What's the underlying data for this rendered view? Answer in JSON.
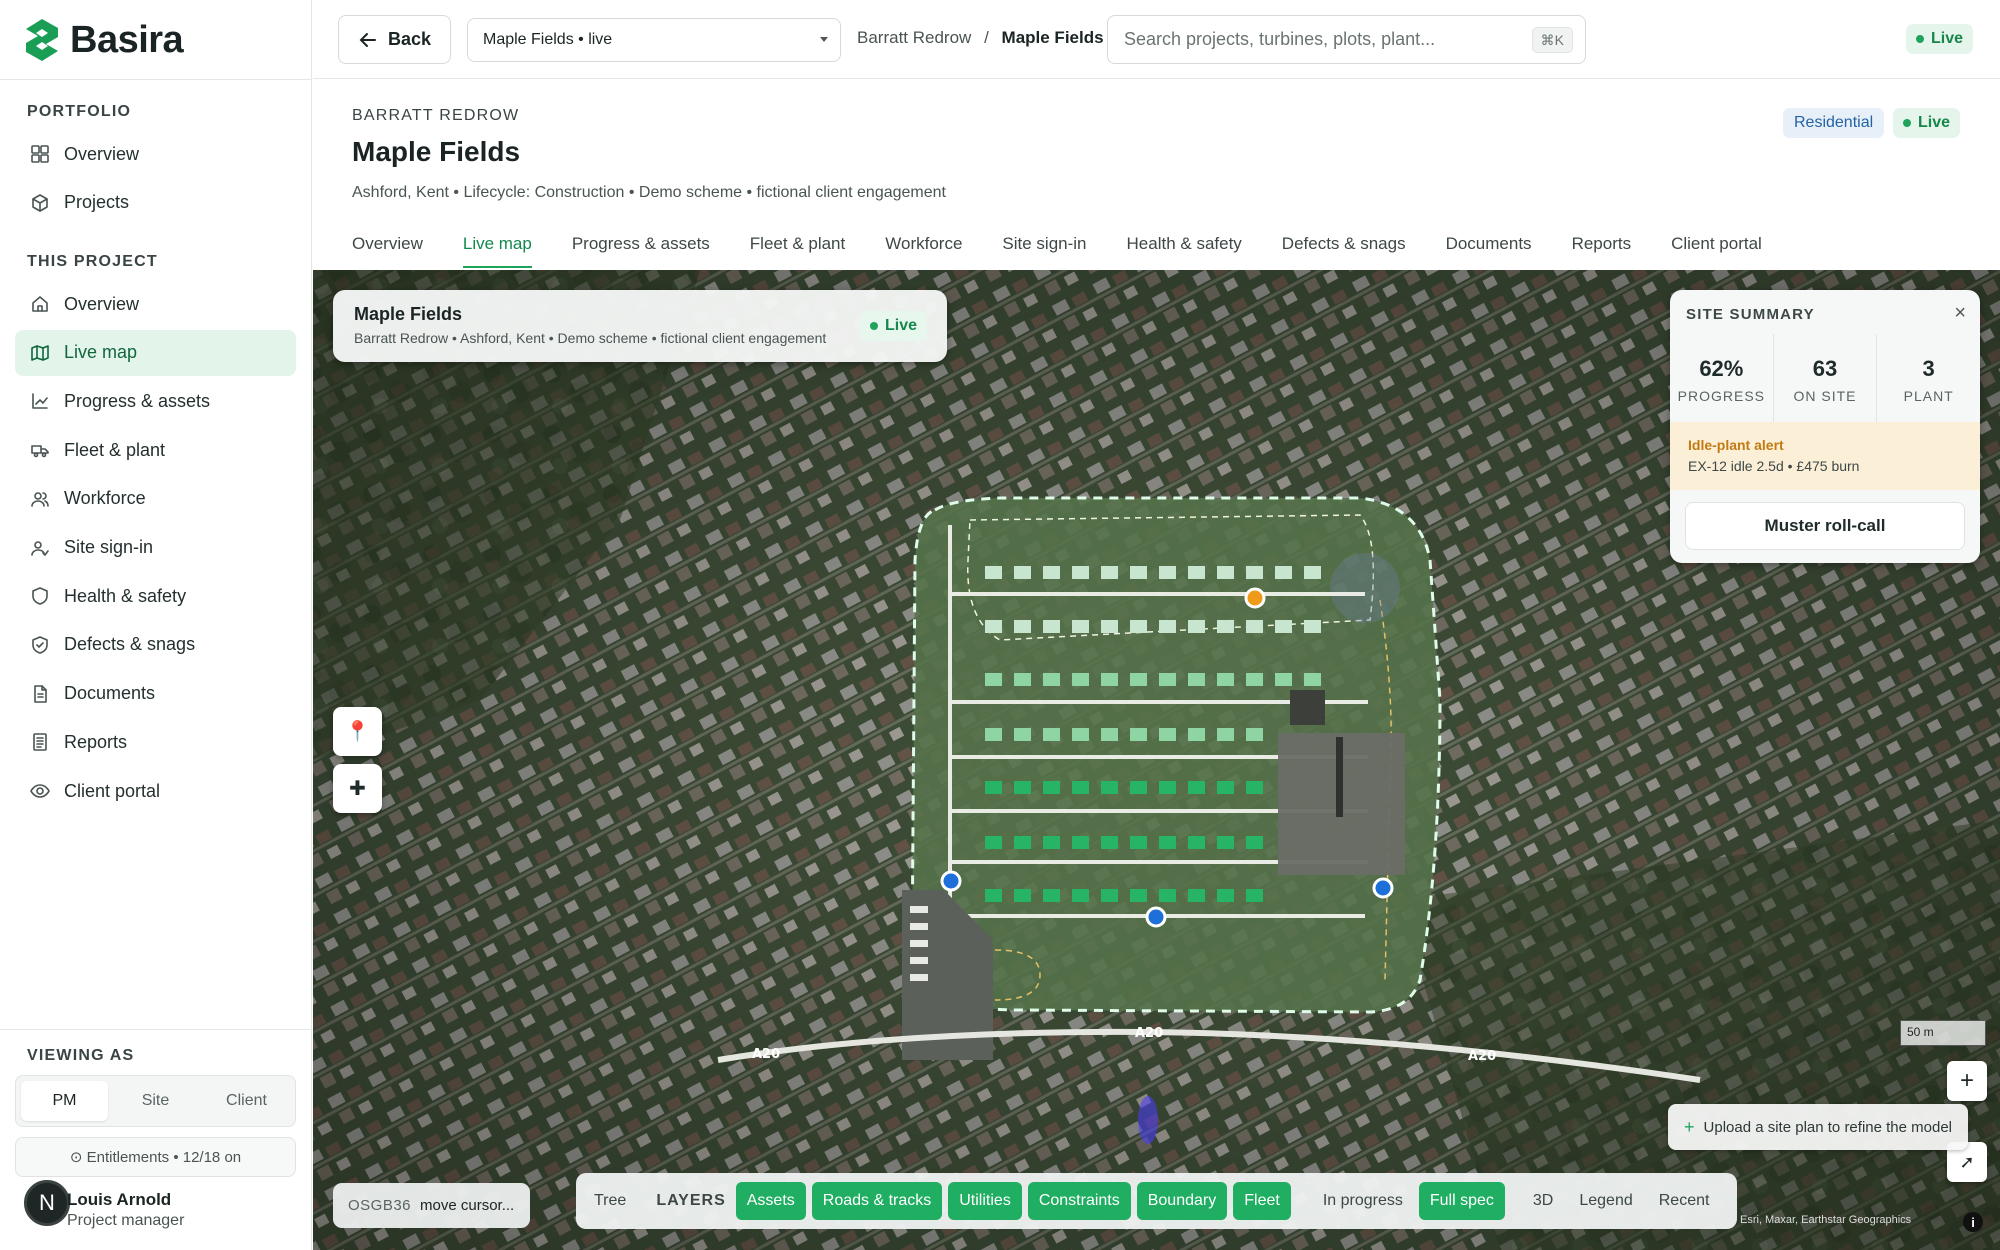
{
  "app": {
    "name": "Basira"
  },
  "sidebar": {
    "portfolio_heading": "PORTFOLIO",
    "portfolio_items": [
      {
        "label": "Overview",
        "icon": "grid-icon"
      },
      {
        "label": "Projects",
        "icon": "box-icon"
      }
    ],
    "project_heading": "THIS PROJECT",
    "project_items": [
      {
        "label": "Overview",
        "icon": "home-icon"
      },
      {
        "label": "Live map",
        "icon": "map-icon",
        "active": true
      },
      {
        "label": "Progress & assets",
        "icon": "chart-icon"
      },
      {
        "label": "Fleet & plant",
        "icon": "truck-icon"
      },
      {
        "label": "Workforce",
        "icon": "users-icon"
      },
      {
        "label": "Site sign-in",
        "icon": "user-check-icon"
      },
      {
        "label": "Health & safety",
        "icon": "shield-icon"
      },
      {
        "label": "Defects & snags",
        "icon": "shield-check-icon"
      },
      {
        "label": "Documents",
        "icon": "document-icon"
      },
      {
        "label": "Reports",
        "icon": "report-icon"
      },
      {
        "label": "Client portal",
        "icon": "eye-icon"
      }
    ],
    "viewing_heading": "VIEWING AS",
    "viewing_options": [
      "PM",
      "Site",
      "Client"
    ],
    "viewing_selected": "PM",
    "entitlements": "⊙ Entitlements • 12/18 on",
    "user": {
      "initial": "N",
      "name": "Louis Arnold",
      "role": "Project manager"
    }
  },
  "topbar": {
    "back_label": "Back",
    "project_select": "Maple Fields • live",
    "breadcrumb": {
      "parent": "Barratt Redrow",
      "separator": "/",
      "current": "Maple Fields"
    },
    "search_placeholder": "Search projects, turbines, plots, plant...",
    "search_shortcut": "⌘K",
    "status": "Live"
  },
  "header": {
    "kicker": "BARRATT REDROW",
    "title": "Maple Fields",
    "subtitle": "Ashford, Kent • Lifecycle: Construction • Demo scheme • fictional client engagement",
    "badge_type": "Residential",
    "badge_status": "Live"
  },
  "tabs": [
    "Overview",
    "Live map",
    "Progress & assets",
    "Fleet & plant",
    "Workforce",
    "Site sign-in",
    "Health & safety",
    "Defects & snags",
    "Documents",
    "Reports",
    "Client portal"
  ],
  "tabs_active": "Live map",
  "map": {
    "info": {
      "title": "Maple Fields",
      "subtitle": "Barratt Redrow • Ashford, Kent • Demo scheme • fictional client engagement",
      "status": "Live"
    },
    "summary": {
      "heading": "SITE SUMMARY",
      "stats": [
        {
          "value": "62%",
          "label": "PROGRESS"
        },
        {
          "value": "63",
          "label": "ON SITE"
        },
        {
          "value": "3",
          "label": "PLANT"
        }
      ],
      "alert_title": "Idle-plant alert",
      "alert_text": "EX-12 idle 2.5d • £475 burn",
      "action": "Muster roll-call"
    },
    "road_labels": [
      "A20",
      "A20",
      "A20"
    ],
    "scale_label": "50 m",
    "upload_label": "Upload a site plan to refine the model",
    "coords": {
      "system": "OSGB36",
      "value": "move cursor..."
    },
    "layer_bar": {
      "tree": "Tree",
      "layers_label": "LAYERS",
      "layers": [
        "Assets",
        "Roads & tracks",
        "Utilities",
        "Constraints",
        "Boundary",
        "Fleet"
      ],
      "in_progress": "In progress",
      "full_spec": "Full spec",
      "view_3d": "3D",
      "legend": "Legend",
      "recent": "Recent"
    },
    "attribution": "Esri, Maxar, Earthstar Geographics",
    "colors": {
      "plot": "#27b466",
      "plot_light": "#c8e6cf",
      "boundary": "#dffbe9",
      "marker_blue": "#1e6fd9",
      "marker_orange": "#f09a1a"
    }
  }
}
